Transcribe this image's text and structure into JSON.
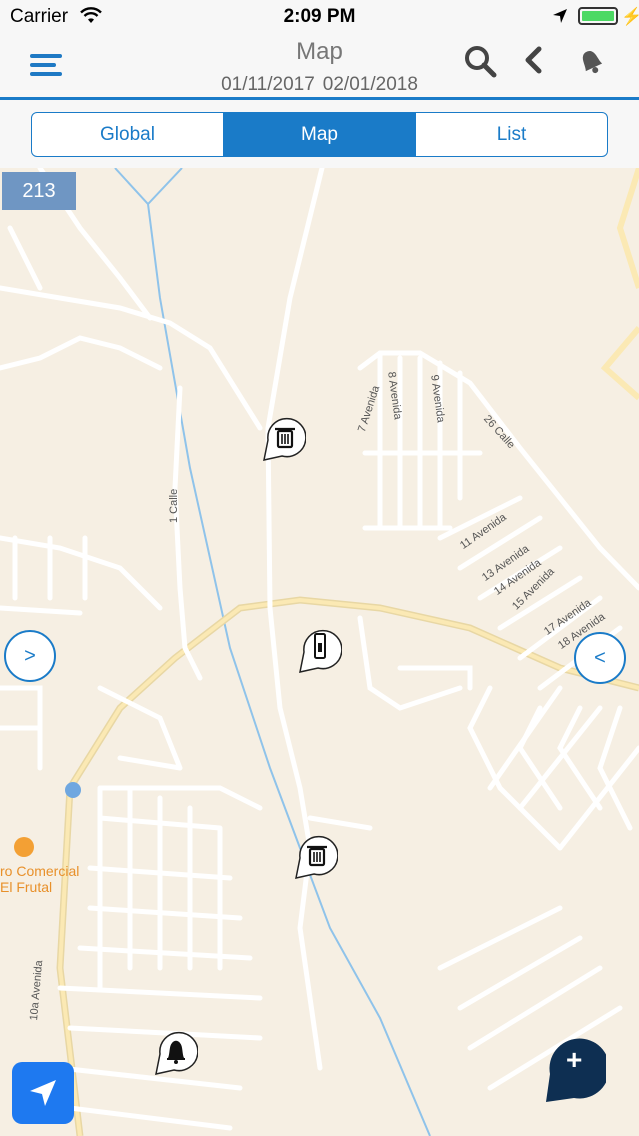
{
  "status_bar": {
    "carrier": "Carrier",
    "time": "2:09 PM"
  },
  "header": {
    "title": "Map",
    "date_from": "01/11/2017",
    "date_to": "02/01/2018"
  },
  "segments": [
    {
      "label": "Global",
      "active": false
    },
    {
      "label": "Map",
      "active": true
    },
    {
      "label": "List",
      "active": false
    }
  ],
  "map": {
    "counter": "213",
    "streets": [
      "7 Avenida",
      "8 Avenida",
      "9 Avenida",
      "26 Calle",
      "1 Calle",
      "11 Avenida",
      "13 Avenida",
      "14 Avenida",
      "15 Avenida",
      "17 Avenida",
      "18 Avenida",
      "10a Avenida"
    ],
    "poi_label_line1": "ro Comercial",
    "poi_label_line2": "El Frutal",
    "left_arrow": ">",
    "right_arrow": "<",
    "pins": [
      "trash-pin-icon",
      "phone-pin-icon",
      "trash-pin-icon",
      "bell-pin-icon"
    ],
    "add_label": "+"
  },
  "colors": {
    "accent": "#1a7bc8",
    "map_bg": "#f6efe3",
    "road": "#ffffff",
    "highway": "#f8e3a8",
    "water": "#8fc3ea"
  }
}
